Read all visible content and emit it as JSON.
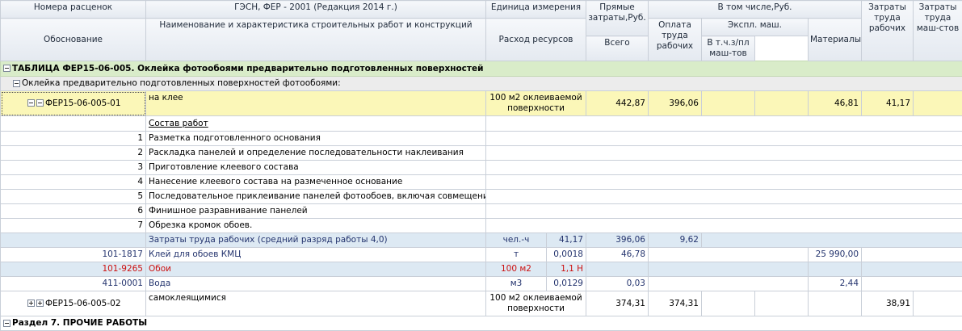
{
  "header": {
    "rate_numbers": "Номера расценок",
    "basis": "Обоснование",
    "gesn_title": "ГЭСН, ФЕР - 2001 (Редакция 2014 г.)",
    "name_desc": "Наименование и характеристика строительных работ и конструкций",
    "unit": "Единица измерения",
    "resource_use": "Расход ресурсов",
    "direct_costs": "Прямые затраты,Руб.",
    "including": "В том числе,Руб.",
    "worker_pay": "Оплата труда рабочих",
    "machine_ops": "Экспл. маш.",
    "total": "Всего",
    "incl_machinist": "В т.ч.з/пл маш-тов",
    "materials": "Материалы",
    "labor_workers": "Затраты труда рабочих",
    "labor_machinists": "Затраты труда маш-стов"
  },
  "table_row": {
    "label": "ТАБЛИЦА ФЕР15-06-005. Оклейка фотообоями предварительно подготовленных поверхностей"
  },
  "group_row": {
    "label": "Оклейка предварительно подготовленных поверхностей фотообоями:"
  },
  "item1": {
    "code": "ФЕР15-06-005-01",
    "name": "на клее",
    "unit": "100 м2 оклеиваемой поверхности",
    "direct": "442,87",
    "pay": "396,06",
    "materials": "46,81",
    "labor": "41,17"
  },
  "work_title": "Состав работ",
  "steps": [
    {
      "n": "1",
      "text": "Разметка подготовленного основания"
    },
    {
      "n": "2",
      "text": "Раскладка панелей и определение последовательности наклеивания"
    },
    {
      "n": "3",
      "text": "Приготовление клеевого состава"
    },
    {
      "n": "4",
      "text": "Нанесение клеевого состава на размеченное основание"
    },
    {
      "n": "5",
      "text": "Последовательное приклеивание панелей фотообоев, включая совмещение и обработку стыков"
    },
    {
      "n": "6",
      "text": "Финишное разравнивание панелей"
    },
    {
      "n": "7",
      "text": "Обрезка кромок обоев."
    }
  ],
  "labor_row": {
    "name": "Затраты труда рабочих (средний разряд работы 4,0)",
    "unit": "чел.-ч",
    "qty": "41,17",
    "direct": "396,06",
    "pay": "9,62"
  },
  "resources": [
    {
      "code": "101-1817",
      "name": "Клей для обоев КМЦ",
      "unit": "т",
      "qty": "0,0018",
      "direct": "46,78",
      "materials": "25 990,00"
    },
    {
      "code": "101-9265",
      "name": "Обои",
      "unit": "100 м2",
      "qty": "1,1 Н",
      "direct": "",
      "materials": ""
    },
    {
      "code": "411-0001",
      "name": "Вода",
      "unit": "м3",
      "qty": "0,0129",
      "direct": "0,03",
      "materials": "2,44"
    }
  ],
  "item2": {
    "code": "ФЕР15-06-005-02",
    "name": "самоклеящимися",
    "unit": "100 м2 оклеиваемой поверхности",
    "direct": "374,31",
    "pay": "374,31",
    "labor": "38,91"
  },
  "section_row": {
    "label": "Раздел 7. ПРОЧИЕ РАБОТЫ"
  }
}
